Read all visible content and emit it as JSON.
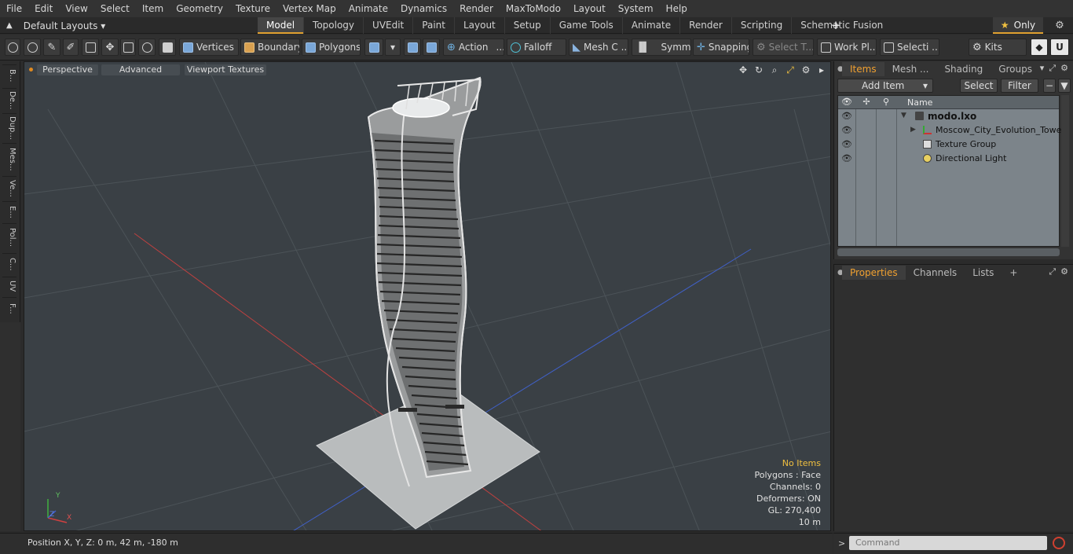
{
  "menu": [
    "File",
    "Edit",
    "View",
    "Select",
    "Item",
    "Geometry",
    "Texture",
    "Vertex Map",
    "Animate",
    "Dynamics",
    "Render",
    "MaxToModo",
    "Layout",
    "System",
    "Help"
  ],
  "layout": {
    "label": "Default Layouts",
    "arrow": "▾"
  },
  "layout_tabs": [
    "Model",
    "Topology",
    "UVEdit",
    "Paint",
    "Layout",
    "Setup",
    "Game Tools",
    "Animate",
    "Render",
    "Scripting",
    "Schematic Fusion"
  ],
  "only_label": "Only",
  "toolbar": {
    "vertices": "Vertices",
    "boundary": "Boundary",
    "polygons": "Polygons",
    "action": "Action",
    "falloff": "Falloff",
    "mesh": "Mesh C ...",
    "symm": "Symm ...",
    "snapping": "Snapping",
    "select_t": "Select T...",
    "work_pl": "Work Pl...",
    "selecti": "Selecti ...",
    "kits": "Kits"
  },
  "left_tabs": [
    "B...",
    "De...",
    "Dup...",
    "Mes...",
    "Ve...",
    "E...",
    "Pol...",
    "C...",
    "UV",
    "F..."
  ],
  "viewport": {
    "perspective": "Perspective",
    "advanced": "Advanced",
    "viewport_textures": "Viewport Textures",
    "info": {
      "no_items": "No Items",
      "polygons": "Polygons : Face",
      "channels": "Channels: 0",
      "deformers": "Deformers: ON",
      "gl": "GL: 270,400",
      "scale": "10 m"
    },
    "axis_labels": {
      "y": "Y",
      "x": "X",
      "z": "Z"
    }
  },
  "items_panel": {
    "tabs": [
      "Items",
      "Mesh ...",
      "Shading",
      "Groups"
    ],
    "add_item": "Add Item",
    "select": "Select",
    "filter": "Filter",
    "col_name": "Name",
    "rows": [
      {
        "name": "modo.lxo"
      },
      {
        "name": "Moscow_City_Evolution_Tower"
      },
      {
        "name": "Texture Group"
      },
      {
        "name": "Directional Light"
      }
    ]
  },
  "properties_panel": {
    "tabs": [
      "Properties",
      "Channels",
      "Lists"
    ],
    "add": "+"
  },
  "status": {
    "position": "Position X, Y, Z:   0 m, 42 m, -180 m"
  },
  "command": {
    "placeholder": "Command"
  }
}
